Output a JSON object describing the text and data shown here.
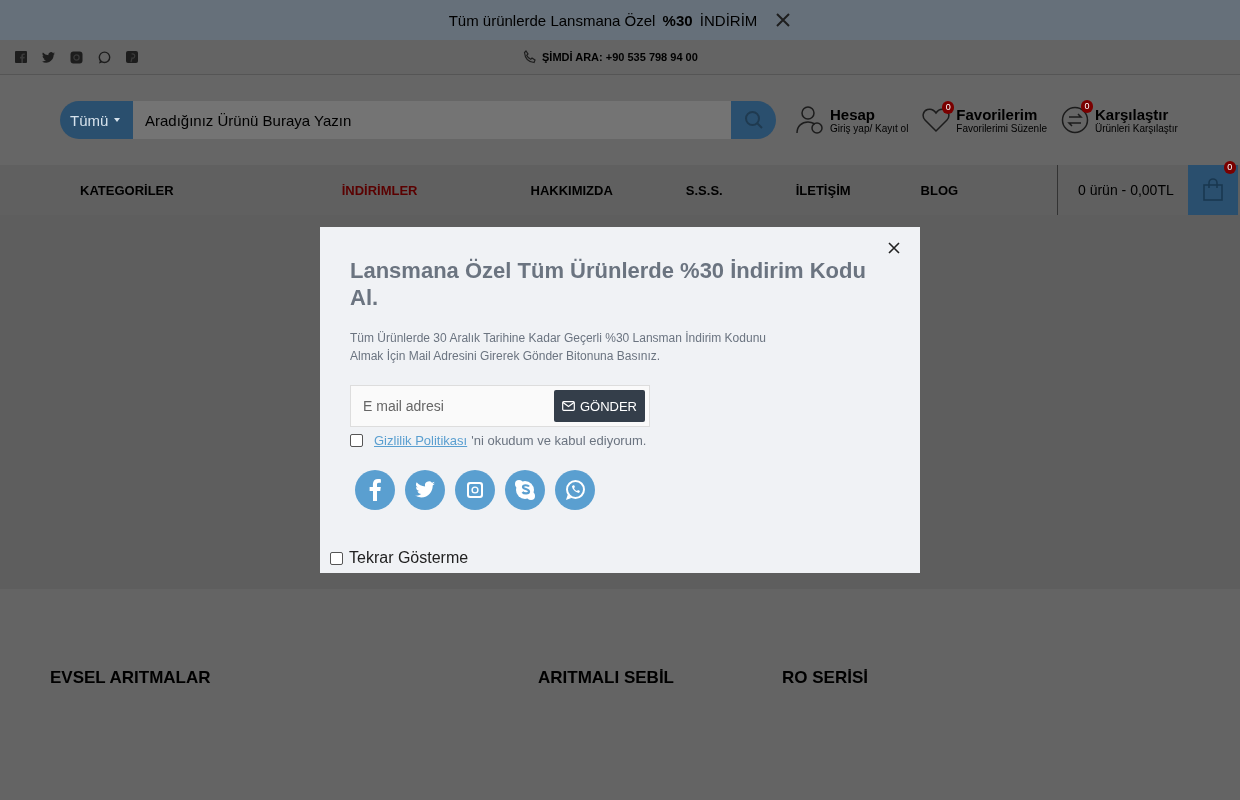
{
  "announcement": {
    "text": "Tüm ürünlerde Lansmana Özel **%30** İNDİRİM"
  },
  "topbar": {
    "phone": "ŞİMDİ ARA: +90 535 798 94 00"
  },
  "search": {
    "category": "Tümü",
    "placeholder": "Aradığınız Ürünü Buraya Yazın"
  },
  "header_links": [
    {
      "kind": "account",
      "title": "Hesap",
      "subtitle": "Giriş yap/ Kayıt ol"
    },
    {
      "kind": "favorites",
      "title": "Favorilerim",
      "subtitle": "Favorilerimi Süzenle",
      "count": "0"
    },
    {
      "kind": "compare",
      "title": "Karşılaştır",
      "subtitle": "Ürünleri Karşılaştır",
      "count": "0"
    }
  ],
  "nav": [
    {
      "label": "KATEGORİLER",
      "highlight": false
    },
    {
      "label": "İNDİRİMLER",
      "highlight": true
    },
    {
      "label": "HAKKIMIZDA",
      "highlight": false
    },
    {
      "label": "S.S.S.",
      "highlight": false
    },
    {
      "label": "İLETİŞİM",
      "highlight": false
    },
    {
      "label": "BLOG",
      "highlight": false
    }
  ],
  "cart": {
    "summary": "0 ürün - 0,00TL",
    "count": "0"
  },
  "modal": {
    "title": "Lansmana Özel Tüm Ürünlerde %30 İndirim Kodu Al.",
    "text": "Tüm Ürünlerde 30 Aralık Tarihine Kadar Geçerli %30 Lansman İndirim Kodunu Almak İçin  Mail Adresini Girerek Gönder Bitonuna Basınız.",
    "email_placeholder": "E mail adresi",
    "submit": "GÖNDER",
    "privacy_link": "Gizlilik Politikası",
    "privacy_text": "'ni okudum ve kabul ediyorum.",
    "privacy_checked": false,
    "socials": [
      {
        "kind": "facebook"
      },
      {
        "kind": "twitter"
      },
      {
        "kind": "instagram"
      },
      {
        "kind": "skype"
      },
      {
        "kind": "whatsapp"
      }
    ],
    "dont_show_label": "Tekrar Gösterme",
    "dont_show_checked": false
  },
  "footer_headings": [
    "EVSEL ARITMALAR",
    "ARITMALI SEBİL",
    "RO SERİSİ"
  ]
}
